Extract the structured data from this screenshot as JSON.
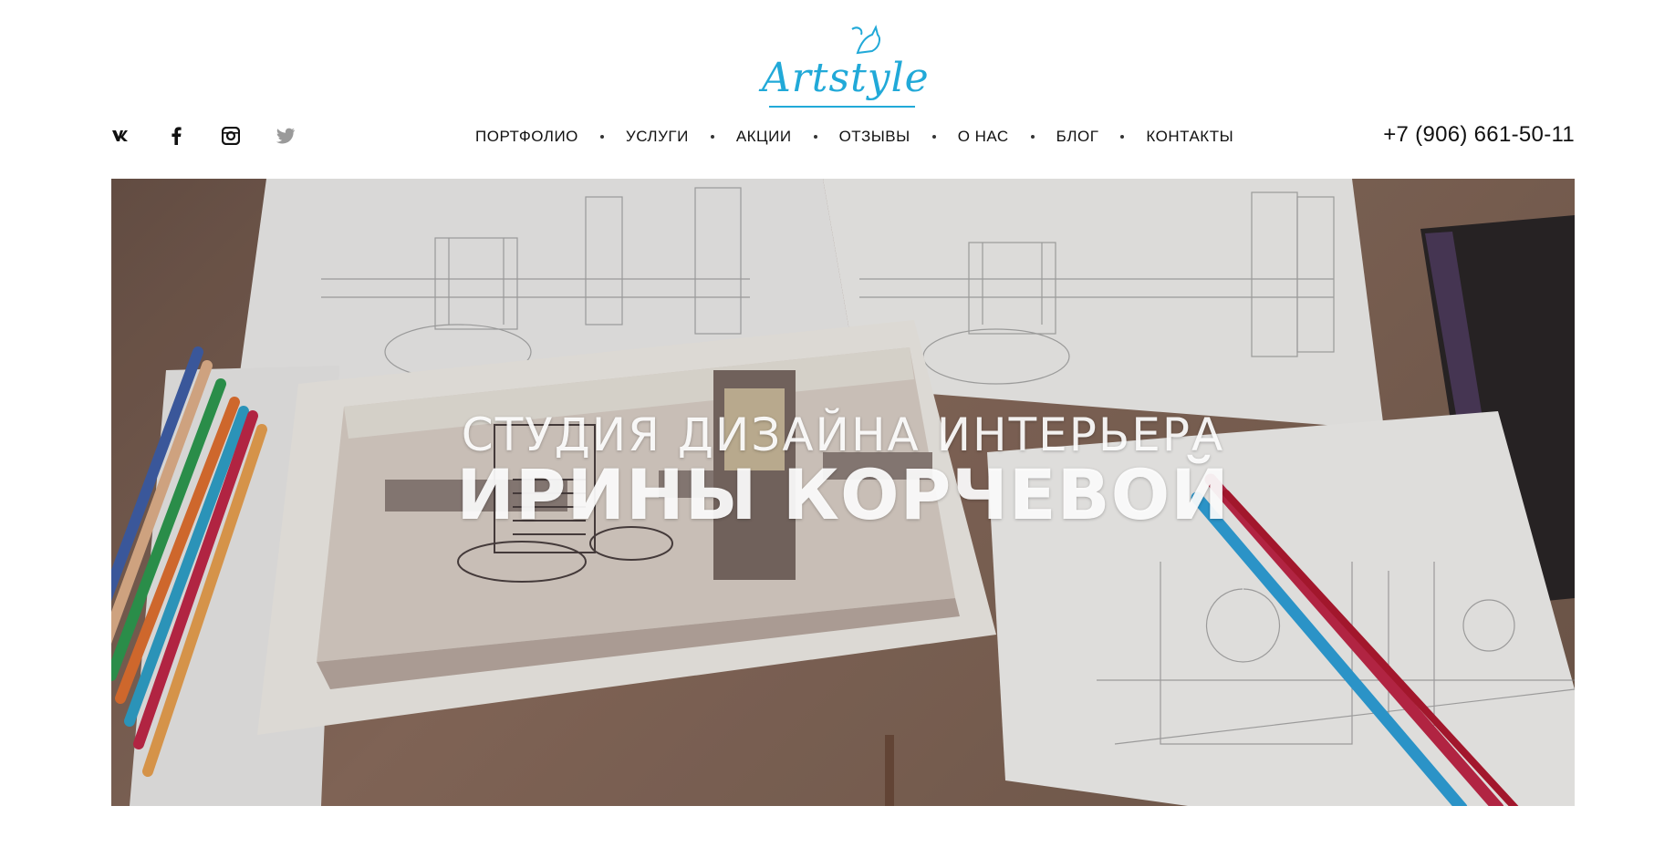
{
  "brand": {
    "logo_text": "Artstyle",
    "accent": "#21a9d8"
  },
  "social": [
    "vk-icon",
    "facebook-icon",
    "instagram-icon",
    "twitter-icon"
  ],
  "nav": {
    "items": [
      {
        "label": "ПОРТФОЛИО"
      },
      {
        "label": "УСЛУГИ"
      },
      {
        "label": "АКЦИИ"
      },
      {
        "label": "ОТЗЫВЫ"
      },
      {
        "label": "О НАС"
      },
      {
        "label": "БЛОГ"
      },
      {
        "label": "КОНТАКТЫ"
      }
    ]
  },
  "phone": "+7 (906) 661-50-11",
  "hero": {
    "line1": "СТУДИЯ ДИЗАЙНА ИНТЕРЬЕРА",
    "line2": "ИРИНЫ КОРЧЕВОЙ"
  }
}
